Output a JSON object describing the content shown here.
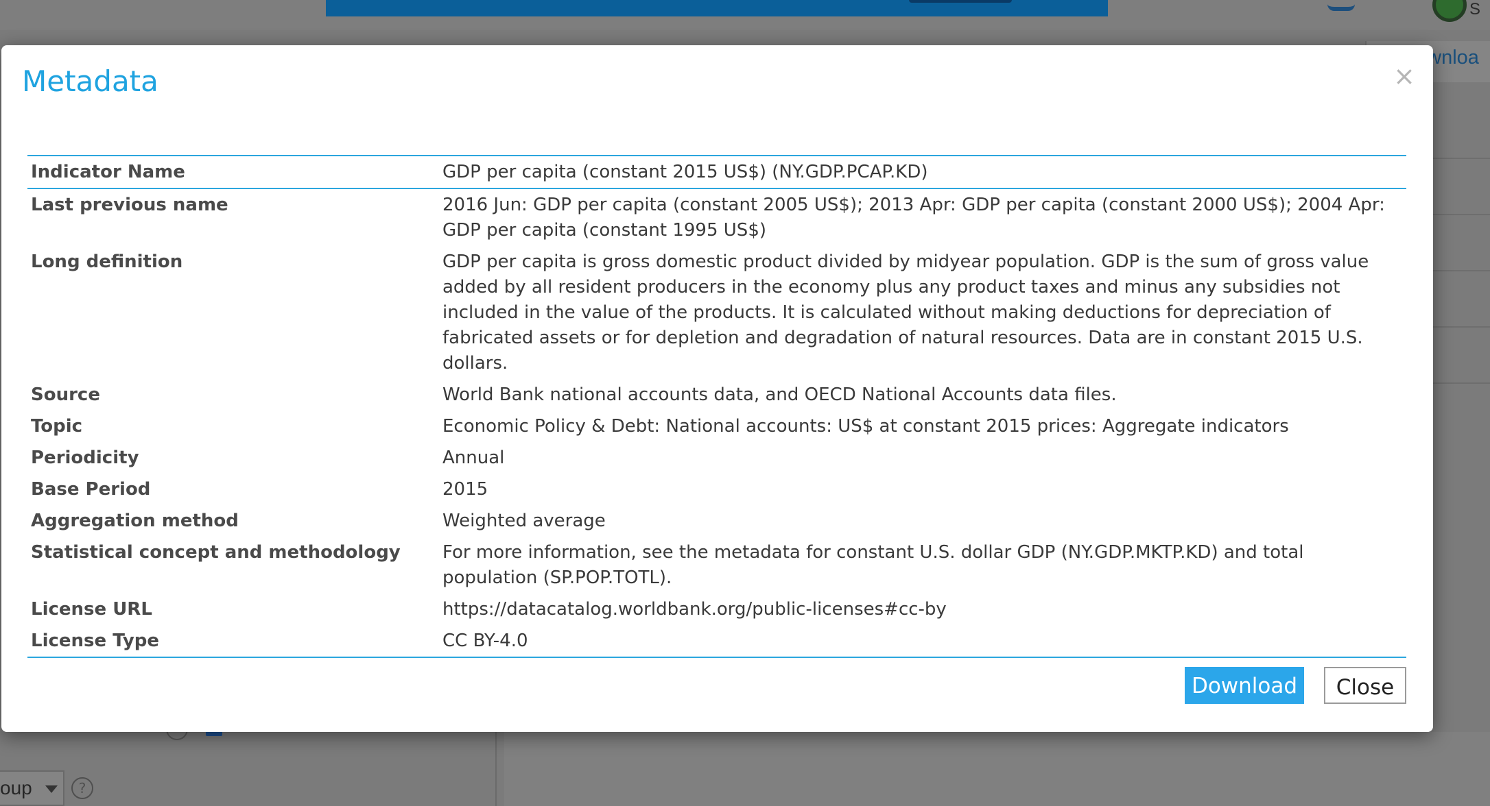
{
  "background": {
    "download_tab_label": "ownloa",
    "top_right_text": "S",
    "group_select_value": "oup",
    "help_glyph": "?"
  },
  "modal": {
    "title": "Metadata",
    "close_glyph": "×",
    "rows": [
      {
        "label": "Indicator Name",
        "value": "GDP per capita (constant 2015 US$) (NY.GDP.PCAP.KD)"
      },
      {
        "label": "Last previous name",
        "value": "2016 Jun: GDP per capita (constant 2005 US$); 2013 Apr: GDP per capita (constant 2000 US$); 2004 Apr: GDP per capita (constant 1995 US$)"
      },
      {
        "label": "Long definition",
        "value": "GDP per capita is gross domestic product divided by midyear population. GDP is the sum of gross value added by all resident producers in the economy plus any product taxes and minus any subsidies not included in the value of the products. It is calculated without making deductions for depreciation of fabricated assets or for depletion and degradation of natural resources. Data are in constant 2015 U.S. dollars."
      },
      {
        "label": "Source",
        "value": "World Bank national accounts data, and OECD National Accounts data files."
      },
      {
        "label": "Topic",
        "value": "Economic Policy & Debt: National accounts: US$ at constant 2015 prices: Aggregate indicators"
      },
      {
        "label": "Periodicity",
        "value": "Annual"
      },
      {
        "label": "Base Period",
        "value": "2015"
      },
      {
        "label": "Aggregation method",
        "value": "Weighted average"
      },
      {
        "label": "Statistical concept and methodology",
        "value": "For more information, see the metadata for constant U.S. dollar GDP (NY.GDP.MKTP.KD) and total population (SP.POP.TOTL)."
      },
      {
        "label": "License URL",
        "value": "https://datacatalog.worldbank.org/public-licenses#cc-by"
      },
      {
        "label": "License Type",
        "value": "CC BY-4.0"
      }
    ],
    "download_label": "Download",
    "close_label": "Close"
  },
  "colors": {
    "accent": "#1fa3e0",
    "button": "#2ba6ea",
    "overlay": "#7b7b7b"
  }
}
